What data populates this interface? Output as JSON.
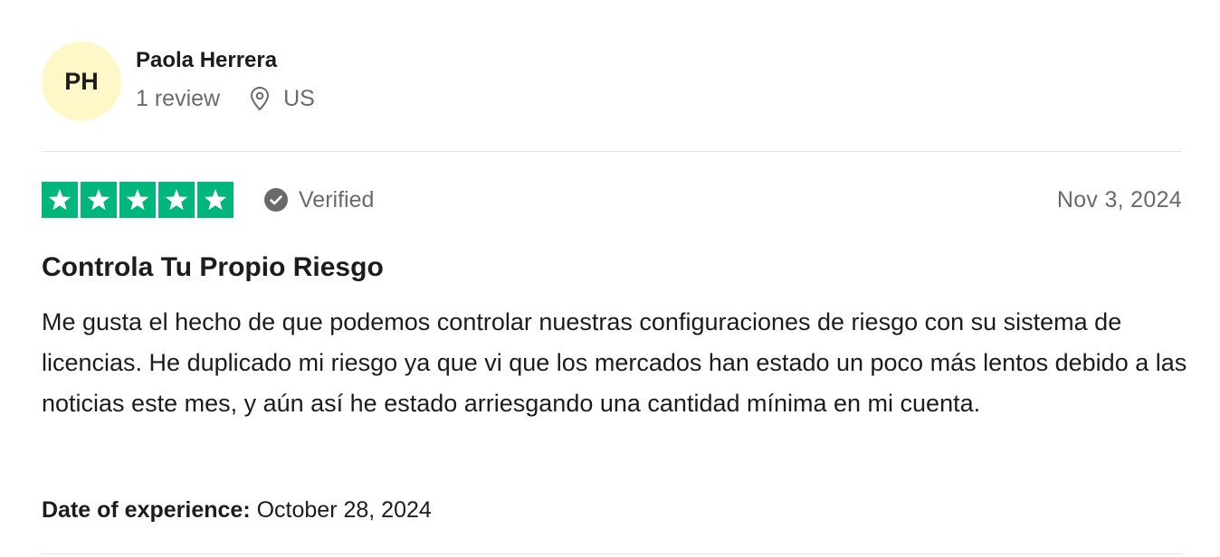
{
  "reviewer": {
    "initials": "PH",
    "name": "Paola Herrera",
    "review_count": "1 review",
    "country": "US",
    "avatar_color": "#fef8c8"
  },
  "rating": {
    "stars": 5,
    "max_stars": 5,
    "star_color": "#00b67a",
    "verified_label": "Verified",
    "date": "Nov 3, 2024"
  },
  "review": {
    "title": "Controla Tu Propio Riesgo",
    "body": "Me gusta el hecho de que podemos controlar nuestras configuraciones de riesgo con su sistema de licencias. He duplicado mi riesgo ya que vi que los mercados han estado un poco más lentos debido a las noticias este mes, y aún así he estado arriesgando una cantidad mínima en mi cuenta."
  },
  "experience": {
    "label": "Date of experience:",
    "date": "October 28, 2024"
  },
  "icons": {
    "location": "location-pin-icon",
    "verified": "check-circle-icon",
    "star": "star-icon"
  }
}
